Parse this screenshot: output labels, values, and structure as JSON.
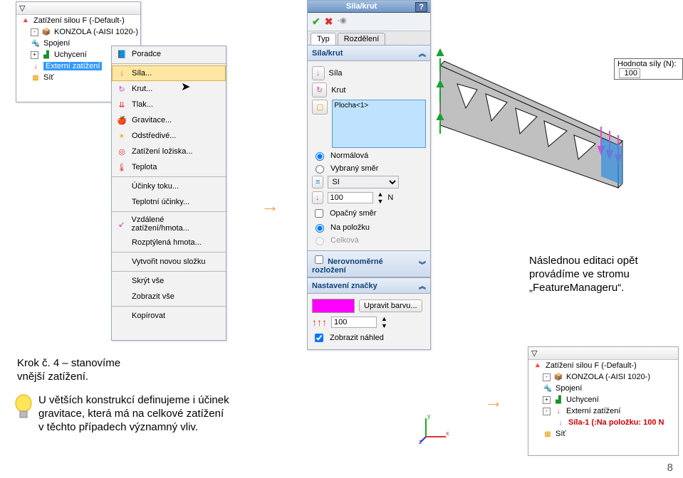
{
  "tree1": {
    "items": [
      {
        "icon": "arrow-red",
        "label": "Zatížení silou F (-Default-)",
        "expand": ""
      },
      {
        "icon": "box-yellow",
        "label": "KONZOLA (-AISI 1020-)",
        "expand": "-"
      },
      {
        "icon": "bolt",
        "label": "Spojení",
        "expand": ""
      },
      {
        "icon": "clamp",
        "label": "Uchycení",
        "expand": "+"
      },
      {
        "icon": "arrow-red",
        "label": "Externí zatížení",
        "selected": true,
        "expand": ""
      },
      {
        "icon": "mesh",
        "label": "Síť",
        "expand": ""
      }
    ]
  },
  "menu": {
    "items": [
      {
        "icon": "book",
        "label": "Poradce",
        "sep": true
      },
      {
        "icon": "arrow-pink",
        "label": "Síla...",
        "hover": true
      },
      {
        "icon": "spin",
        "label": "Krut..."
      },
      {
        "icon": "tlak",
        "label": "Tlak..."
      },
      {
        "icon": "apple",
        "label": "Gravitace..."
      },
      {
        "icon": "cent",
        "label": "Odstředivé..."
      },
      {
        "icon": "bear",
        "label": "Zatížení ložiska..."
      },
      {
        "icon": "therm",
        "label": "Teplota",
        "sep": true
      },
      {
        "icon": "",
        "label": "Účinky toku..."
      },
      {
        "icon": "",
        "label": "Teplotní účinky...",
        "sep": true
      },
      {
        "icon": "remote",
        "label": "Vzdálené zatížení/hmota..."
      },
      {
        "icon": "",
        "label": "Rozptýlená hmota...",
        "sep": true
      },
      {
        "icon": "",
        "label": "Vytvořit novou složku",
        "sep": true
      },
      {
        "icon": "",
        "label": "Skrýt vše"
      },
      {
        "icon": "",
        "label": "Zobrazit vše",
        "sep": true
      },
      {
        "icon": "",
        "label": "Kopírovat"
      }
    ]
  },
  "prop": {
    "title": "Síla/krut",
    "tabs": [
      "Typ",
      "Rozdělení"
    ],
    "section1": "Síla/krut",
    "btn_sila": "Síla",
    "btn_krut": "Krut",
    "face": "Plocha<1>",
    "radio_norm": "Normálová",
    "radio_dir": "Vybraný směr",
    "unit": "SI",
    "value": "100",
    "unit_n": "N",
    "chk_opacny": "Opačný směr",
    "radio_polozka": "Na položku",
    "radio_celkova": "Celková",
    "section_neuro": "Nerovnoměrné rozložení",
    "section_marks": "Nastavení značky",
    "btn_color": "Upravit barvu...",
    "mark_val": "100",
    "chk_preview": "Zobrazit náhled"
  },
  "forcelabel": {
    "pre": "Hodnota síly (N):",
    "val": "100"
  },
  "notes": {
    "edit": "Následnou editaci opět provádíme ve stromu „FeatureManageru“.",
    "step": "Krok č. 4 – stanovíme vnější zatížení.",
    "tip": "U větších konstrukcí definujeme i účinek gravitace, která má na celkové zatížení v těchto případech významný vliv."
  },
  "tree2": {
    "filter": "",
    "items": [
      {
        "icon": "arrow-red",
        "label": "Zatížení silou F (-Default-)",
        "expand": ""
      },
      {
        "icon": "box-yellow",
        "label": "KONZOLA (-AISI 1020-)",
        "expand": "-"
      },
      {
        "icon": "bolt",
        "label": "Spojení",
        "expand": ""
      },
      {
        "icon": "clamp",
        "label": "Uchycení",
        "expand": "+"
      },
      {
        "icon": "arrow-red",
        "label": "Externí zatížení",
        "expand": "-"
      },
      {
        "icon": "arrow-pink",
        "label": "Síla-1 (:Na položku: 100 N",
        "indent": true,
        "err": true
      },
      {
        "icon": "mesh",
        "label": "Síť",
        "expand": ""
      }
    ]
  },
  "pagenum": "8"
}
